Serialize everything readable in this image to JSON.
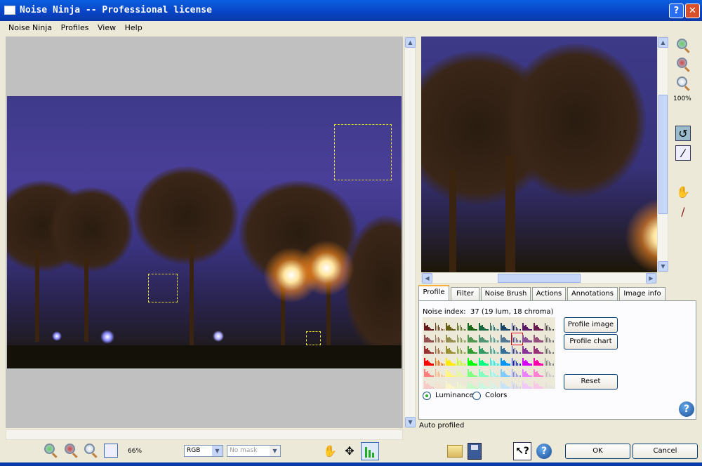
{
  "window": {
    "title": "Noise Ninja -- Professional license",
    "help_btn": "?",
    "close_btn": "✕"
  },
  "menu": [
    "Noise Ninja",
    "Profiles",
    "View",
    "Help"
  ],
  "preview_zoom": "100%",
  "tabs": [
    "Profile",
    "Filter",
    "Noise Brush",
    "Actions",
    "Annotations",
    "Image info"
  ],
  "profile": {
    "noise_index_label": "Noise index:",
    "noise_index_value": "37 (19 lum, 18 chroma)",
    "buttons": {
      "profile_image": "Profile image",
      "profile_chart": "Profile chart",
      "reset": "Reset"
    },
    "radios": [
      {
        "label": "Luminance",
        "checked": true
      },
      {
        "label": "Colors",
        "checked": false
      }
    ],
    "histogram_grid": {
      "columns": 12,
      "rows": 6,
      "selected_cell": {
        "row": 2,
        "col": 9
      }
    }
  },
  "status": "Auto profiled",
  "bottom": {
    "zoom": "66%",
    "channel": "RGB",
    "mask": "No mask",
    "ok": "OK",
    "cancel": "Cancel"
  },
  "icons": [
    "zoom-in-icon",
    "zoom-out-icon",
    "zoom-actual-icon",
    "fit-window-icon",
    "hand-icon",
    "move-icon",
    "histogram-icon",
    "folder-icon",
    "save-icon",
    "whats-this-icon",
    "help-icon",
    "rotate-icon",
    "brush-icon"
  ]
}
